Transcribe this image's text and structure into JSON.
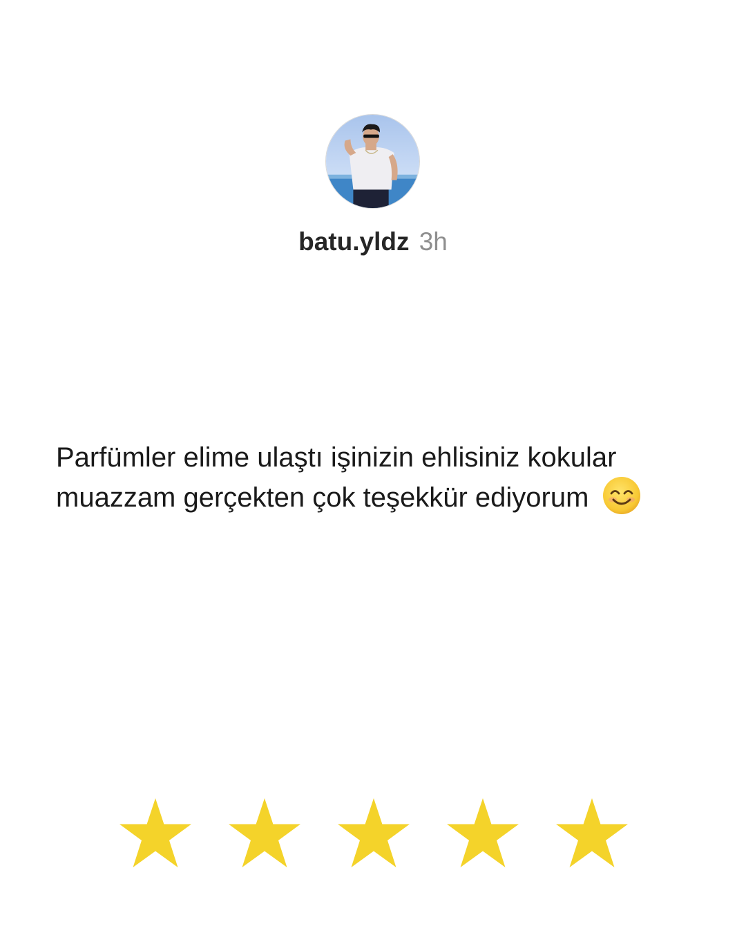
{
  "post": {
    "username": "batu.yldz",
    "time": "3h",
    "comment": "Parfümler elime ulaştı işinizin ehlisiniz kokular muazzam gerçekten çok teşekkür ediyorum"
  },
  "icons": {
    "comment_emoji": "smiling-face-emoji",
    "rating": "star-icon"
  },
  "rating": {
    "value": 5,
    "max": 5,
    "star_color": "#F4D32A"
  }
}
